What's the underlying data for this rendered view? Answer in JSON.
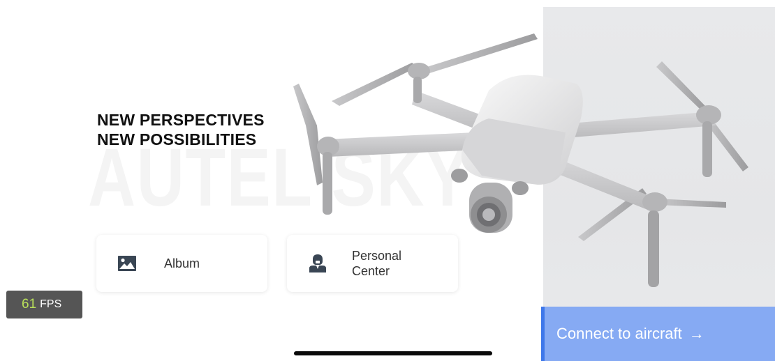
{
  "brand": {
    "watermark": "AUTEL SKY"
  },
  "hero": {
    "line1": "NEW PERSPECTIVES",
    "line2": "NEW POSSIBILITIES"
  },
  "cards": {
    "album": {
      "label": "Album",
      "icon": "image-icon"
    },
    "personal": {
      "label": "Personal Center",
      "icon": "user-icon"
    }
  },
  "fps": {
    "value": "61",
    "unit": "FPS"
  },
  "connect": {
    "label": "Connect to aircraft",
    "arrow": "→"
  },
  "colors": {
    "accent": "#86aaf3",
    "accent_border": "#3f78ea",
    "fps_value": "#b9e05a",
    "panel": "#e7e8ea"
  }
}
